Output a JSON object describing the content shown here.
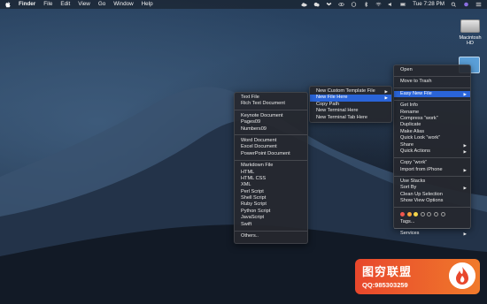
{
  "menubar": {
    "app_name": "Finder",
    "items": [
      "File",
      "Edit",
      "View",
      "Go",
      "Window",
      "Help"
    ],
    "clock": "Tue 7:28 PM"
  },
  "desktop": {
    "drive_label": "Macintosh HD"
  },
  "context_menu": {
    "group1": [
      "Open"
    ],
    "group2": [
      "Move to Trash"
    ],
    "group3": [
      {
        "label": "Easy New File",
        "arrow": true,
        "highlighted": true
      }
    ],
    "group4": [
      {
        "label": "Get Info",
        "arrow": false
      },
      {
        "label": "Rename",
        "arrow": false
      },
      {
        "label": "Compress “work”",
        "arrow": false
      },
      {
        "label": "Duplicate",
        "arrow": false
      },
      {
        "label": "Make Alias",
        "arrow": false
      },
      {
        "label": "Quick Look “work”",
        "arrow": false
      },
      {
        "label": "Share",
        "arrow": true
      },
      {
        "label": "Quick Actions",
        "arrow": true
      }
    ],
    "group5": [
      {
        "label": "Copy “work”",
        "arrow": false
      },
      {
        "label": "Import from iPhone",
        "arrow": true
      }
    ],
    "group6": [
      {
        "label": "Use Stacks",
        "arrow": false
      },
      {
        "label": "Sort By",
        "arrow": true
      },
      {
        "label": "Clean Up Selection",
        "arrow": false
      },
      {
        "label": "Show View Options",
        "arrow": false
      }
    ],
    "tag_colors": [
      "#f0564e",
      "#f5a33c",
      "#f4d54a",
      "#5ac84f",
      "#3d8bf2",
      "#b46be0",
      "#9a9a9a"
    ],
    "tags_label": "Tags...",
    "services_label": "Services"
  },
  "easy_menu": [
    {
      "label": "New Custom Template File",
      "arrow": true,
      "highlighted": false
    },
    {
      "label": "New File Here",
      "arrow": true,
      "highlighted": true
    },
    {
      "label": "Copy Path",
      "arrow": false,
      "highlighted": false
    },
    {
      "label": "New Terminal Here",
      "arrow": false,
      "highlighted": false
    },
    {
      "label": "New Terminal Tab Here",
      "arrow": false,
      "highlighted": false
    }
  ],
  "file_menu": {
    "group1": [
      "Text File",
      "Rich Text Document"
    ],
    "group2": [
      "Keynote Document",
      "Pages09",
      "Numbers09"
    ],
    "group3": [
      "Word Document",
      "Excel Document",
      "PowerPoint Document"
    ],
    "group4": [
      "Markdown File",
      "HTML",
      "HTML CSS",
      "XML",
      "Perl Script",
      "Shell Script",
      "Ruby Script",
      "Python Script",
      "JavaScript",
      "Swift"
    ],
    "group5": [
      "Others.."
    ]
  },
  "watermark": {
    "title": "图穷联盟",
    "qq": "QQ:985303259"
  }
}
